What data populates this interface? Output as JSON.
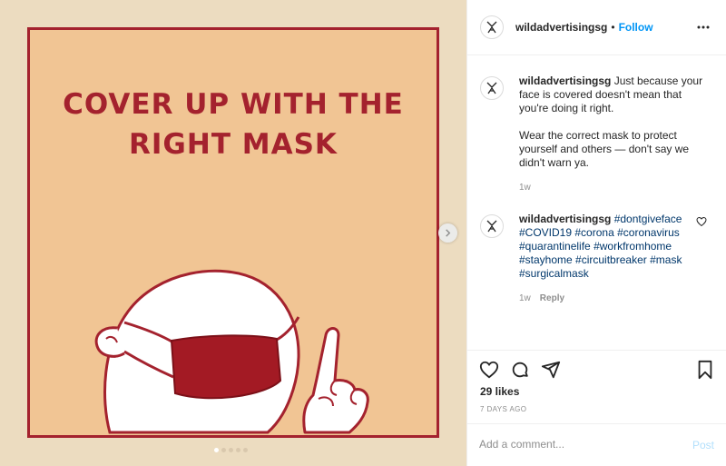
{
  "post": {
    "headline_line1": "COVER UP WITH THE",
    "headline_line2": "RIGHT MASK",
    "carousel": {
      "total": 5,
      "active_index": 0
    }
  },
  "header": {
    "username": "wildadvertisingsg",
    "separator": "•",
    "follow_label": "Follow",
    "more_icon": "ellipsis-icon"
  },
  "caption": {
    "username": "wildadvertisingsg",
    "text1": " Just because your face is covered doesn't mean that you're doing it right.",
    "text2": "Wear the correct mask to protect yourself and others — don't say we didn't warn ya.",
    "time": "1w"
  },
  "hashtag_comment": {
    "username": "wildadvertisingsg",
    "tags": [
      "#dontgiveface",
      "#COVID19",
      "#corona",
      "#coronavirus",
      "#quarantinelife",
      "#workfromhome",
      "#stayhome",
      "#circuitbreaker",
      "#mask",
      "#surgicalmask"
    ],
    "time": "1w",
    "reply_label": "Reply"
  },
  "actions": {
    "likes": "29 likes",
    "posted_ago": "7 DAYS AGO"
  },
  "add_comment": {
    "placeholder": "Add a comment...",
    "post_label": "Post"
  },
  "colors": {
    "brand_red": "#a4222e",
    "card_bg": "#f1c594",
    "outer_bg": "#ecdcc0",
    "link_blue": "#0095f6",
    "hashtag_blue": "#00376b"
  }
}
